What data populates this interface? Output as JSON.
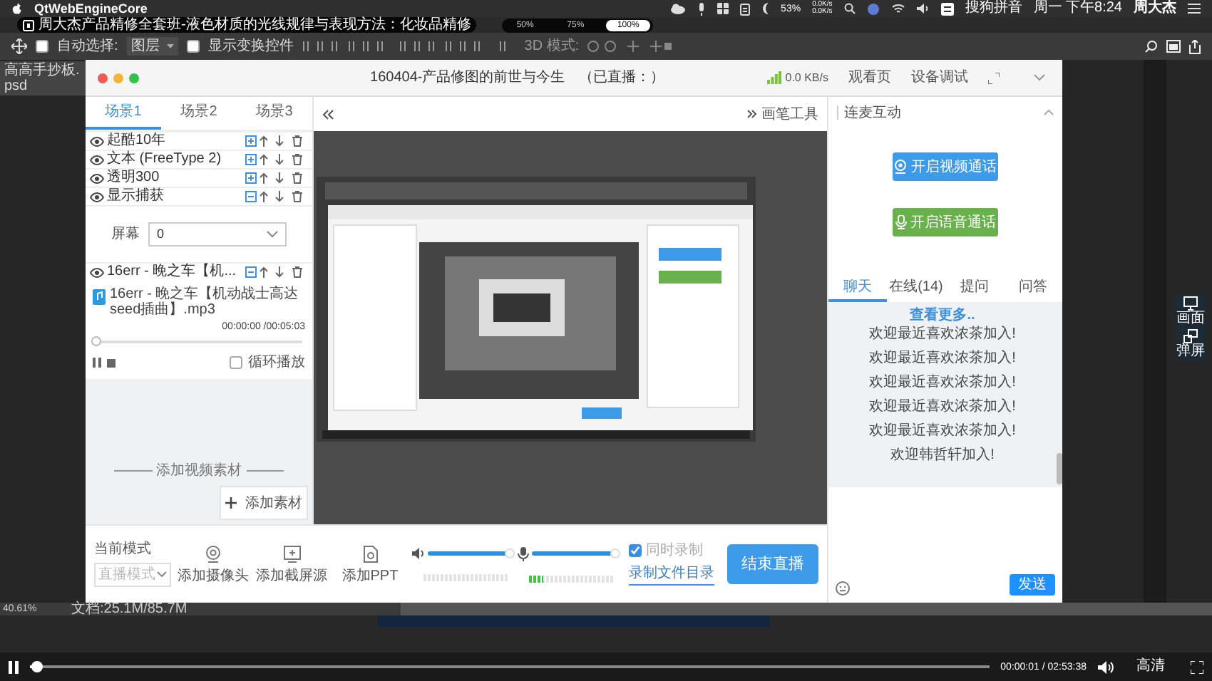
{
  "menubar": {
    "app_name": "QtWebEngineCore",
    "battery": "53%",
    "net_up": "0.0K/s",
    "net_down": "0.0K/s",
    "input_method": "搜狗拼音",
    "clock": "周一 下午8:24",
    "user": "周大杰"
  },
  "video_title": "周大杰产品精修全套班-液色材质的光线规律与表现方法：化妆品精修",
  "zoom_options": [
    {
      "label": "50%",
      "selected": false
    },
    {
      "label": "75%",
      "selected": false
    },
    {
      "label": "100%",
      "selected": true
    }
  ],
  "ps_options": {
    "auto_select_label": "自动选择:",
    "auto_select_checked": false,
    "auto_select_value": "图层",
    "show_transform_label": "显示变换控件",
    "show_transform_checked": false,
    "mode_3d": "3D 模式:"
  },
  "doc_tab": "高高手抄板.psd",
  "app": {
    "title": "160404-产品修图的前世与今生",
    "status": "（已直播：）",
    "speed": "0.0 KB/s",
    "links": [
      "观看页",
      "设备调试"
    ]
  },
  "scenes": [
    {
      "label": "场景1",
      "selected": true
    },
    {
      "label": "场景2",
      "selected": false
    },
    {
      "label": "场景3",
      "selected": false
    }
  ],
  "sources": [
    {
      "name": "起酷10年",
      "expanded": false
    },
    {
      "name": "文本 (FreeType 2)",
      "expanded": false
    },
    {
      "name": "透明300",
      "expanded": false
    },
    {
      "name": "显示捕获",
      "expanded": true,
      "detail": {
        "kind": "screen",
        "label": "屏幕",
        "value": "0"
      }
    },
    {
      "name": "16err - 晚之车【机...",
      "expanded": true,
      "detail": {
        "kind": "media",
        "file": "16err - 晚之车【机动战士高达seed插曲】.mp3",
        "time": "00:00:00 /00:05:03",
        "level": 0,
        "loop_label": "循环播放",
        "loop": false
      }
    }
  ],
  "add_media": {
    "divider_label": "添加视频素材",
    "button": "添加素材"
  },
  "preview_toolbar": {
    "brush_label": "画笔工具"
  },
  "bottom_bar": {
    "mode_label": "当前模式",
    "mode_value": "直播模式",
    "tools": [
      {
        "label": "添加摄像头",
        "kind": "camera"
      },
      {
        "label": "添加截屏源",
        "kind": "screen"
      },
      {
        "label": "添加PPT",
        "kind": "ppt"
      }
    ],
    "speaker": {
      "level": 1.0,
      "meter": {
        "level": 0
      }
    },
    "mic": {
      "level": 1.0,
      "meter": {
        "level": 0.16
      }
    },
    "record": {
      "label": "同时录制",
      "checked": true
    },
    "record_dir": "录制文件目录",
    "end_button": "结束直播"
  },
  "interaction": {
    "title": "连麦互动",
    "call_buttons": [
      {
        "label": "开启视频通话",
        "kind": "video"
      },
      {
        "label": "开启语音通话",
        "kind": "voice"
      }
    ],
    "tabs": [
      {
        "label": "聊天",
        "selected": true
      },
      {
        "label": "在线(14)",
        "selected": false
      },
      {
        "label": "提问",
        "selected": false
      },
      {
        "label": "问答",
        "selected": false
      }
    ],
    "more_link": "查看更多..",
    "messages": [
      "欢迎最近喜欢浓茶加入!",
      "欢迎最近喜欢浓茶加入!",
      "欢迎最近喜欢浓茶加入!",
      "欢迎最近喜欢浓茶加入!",
      "欢迎最近喜欢浓茶加入!",
      "欢迎韩哲轩加入!"
    ],
    "send": "发送"
  },
  "side_float": [
    {
      "label": "画面",
      "kind": "monitor"
    },
    {
      "label": "弹屏",
      "kind": "windows"
    }
  ],
  "ps_status": {
    "zoom": "40.61%",
    "doc": "文档:25.1M/85.7M"
  },
  "player": {
    "level": 0.004,
    "time": "00:00:01 / 02:53:38",
    "quality": "高清"
  }
}
